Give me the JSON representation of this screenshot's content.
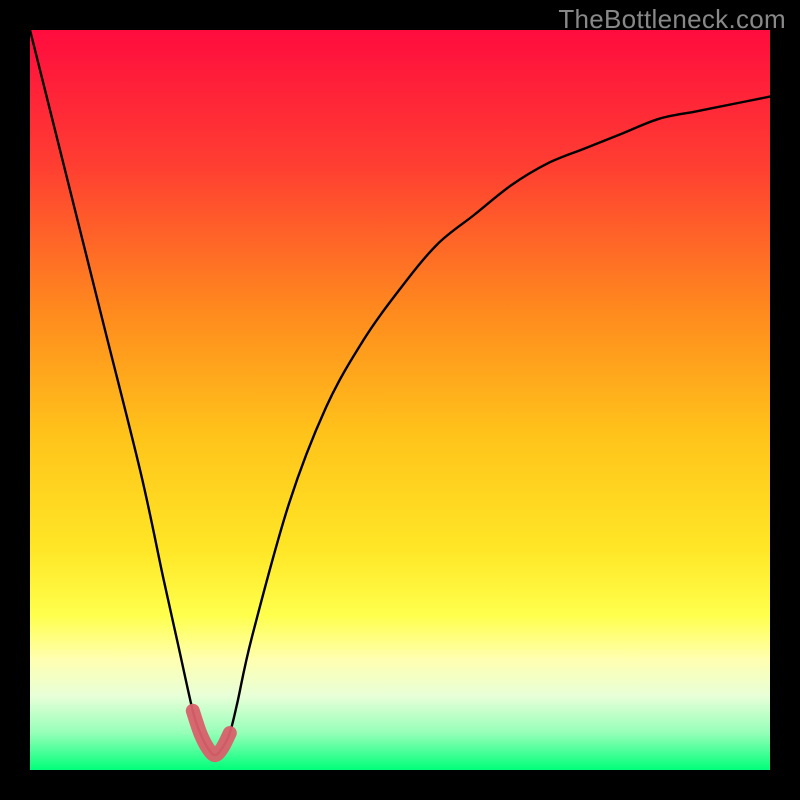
{
  "watermark": "TheBottleneck.com",
  "chart_data": {
    "type": "line",
    "title": "",
    "xlabel": "",
    "ylabel": "",
    "xlim": [
      0,
      100
    ],
    "ylim": [
      0,
      100
    ],
    "grid": false,
    "legend": false,
    "series": [
      {
        "name": "bottleneck-curve",
        "x": [
          0,
          5,
          10,
          15,
          18,
          20,
          22,
          23,
          24,
          25,
          26,
          27,
          28,
          30,
          35,
          40,
          45,
          50,
          55,
          60,
          65,
          70,
          75,
          80,
          85,
          90,
          95,
          100
        ],
        "values": [
          100,
          80,
          60,
          40,
          26,
          17,
          8,
          5,
          3,
          2,
          3,
          5,
          9,
          18,
          36,
          49,
          58,
          65,
          71,
          75,
          79,
          82,
          84,
          86,
          88,
          89,
          90,
          91
        ]
      },
      {
        "name": "optimal-marker",
        "x": [
          22,
          23,
          24,
          25,
          26,
          27
        ],
        "values": [
          8,
          5,
          3,
          2,
          3,
          5
        ]
      }
    ],
    "gradient_stops": [
      {
        "pos": 0.0,
        "color": "#ff0c3e"
      },
      {
        "pos": 0.18,
        "color": "#ff3d32"
      },
      {
        "pos": 0.38,
        "color": "#ff8a1e"
      },
      {
        "pos": 0.55,
        "color": "#ffc41a"
      },
      {
        "pos": 0.7,
        "color": "#ffe626"
      },
      {
        "pos": 0.79,
        "color": "#ffff4c"
      },
      {
        "pos": 0.85,
        "color": "#ffffb0"
      },
      {
        "pos": 0.9,
        "color": "#e8ffd8"
      },
      {
        "pos": 0.95,
        "color": "#95ffb8"
      },
      {
        "pos": 1.0,
        "color": "#00ff7a"
      }
    ]
  }
}
